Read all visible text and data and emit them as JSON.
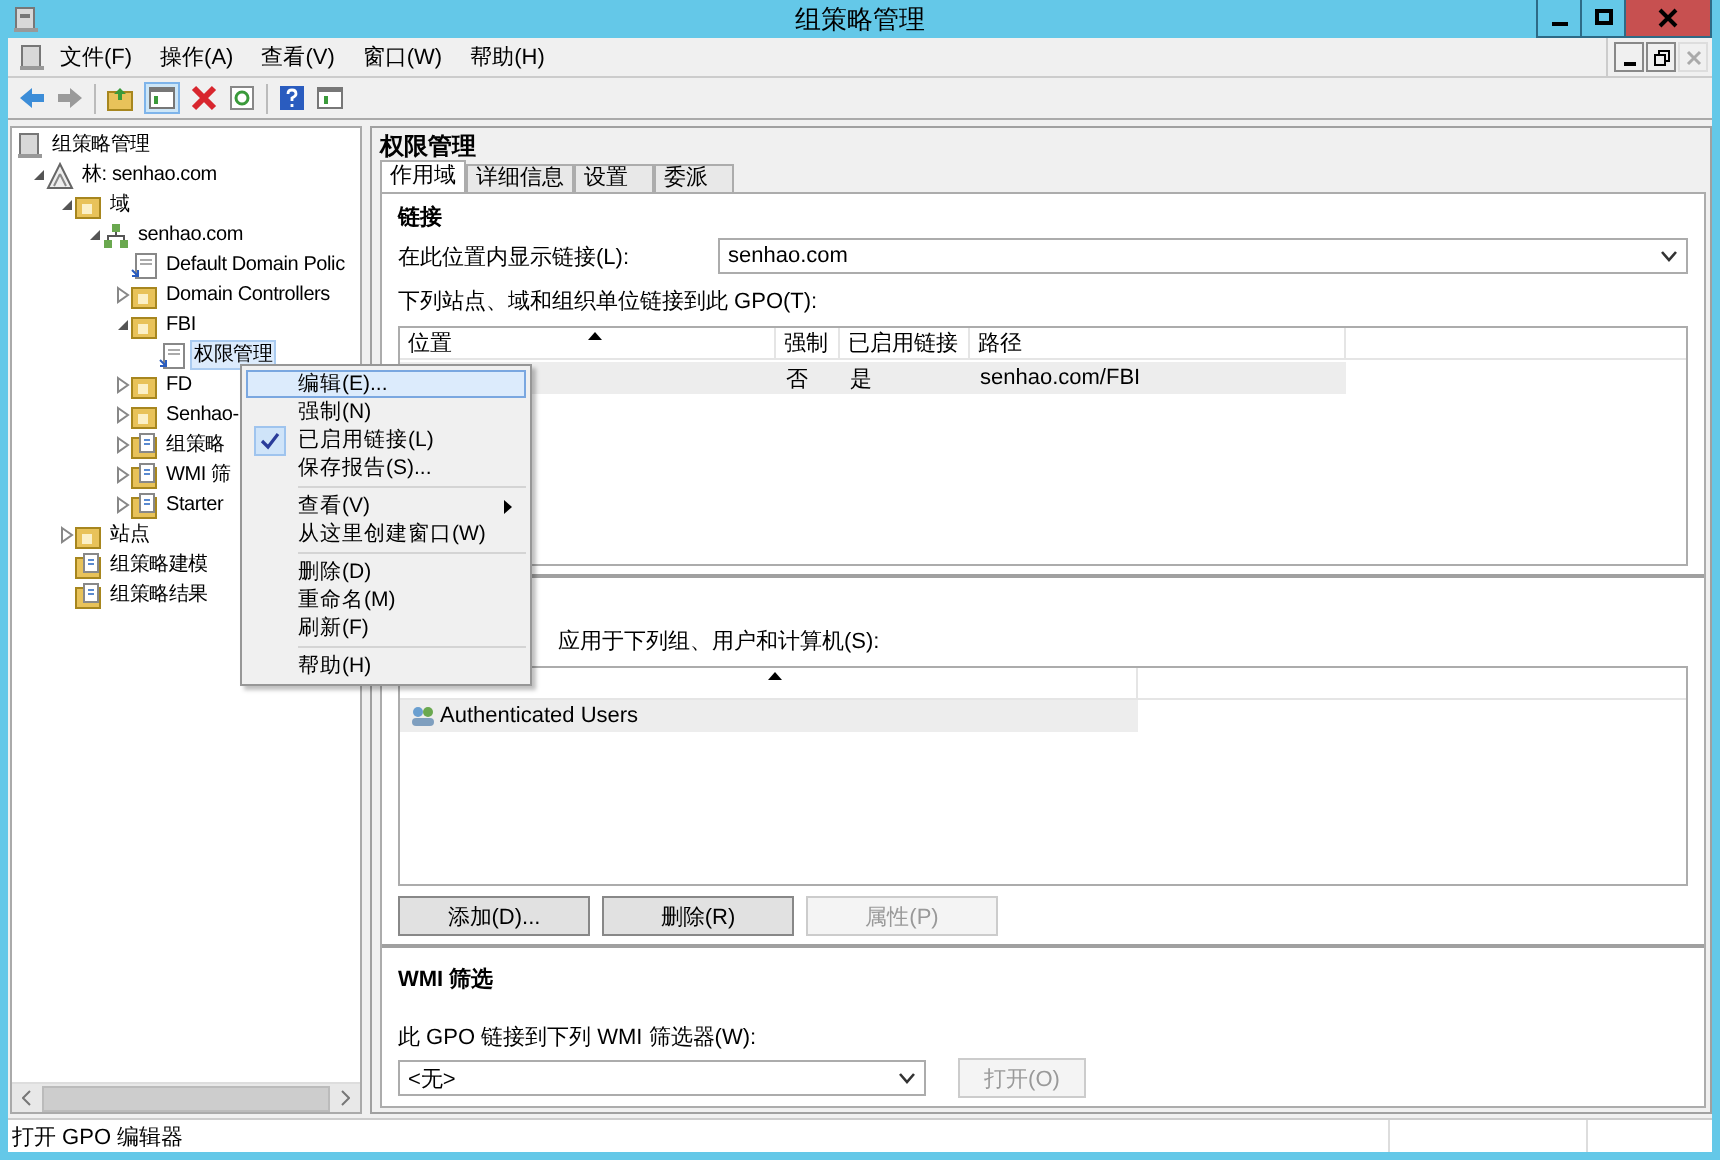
{
  "window": {
    "title": "组策略管理"
  },
  "menu_bar": [
    "文件(F)",
    "操作(A)",
    "查看(V)",
    "窗口(W)",
    "帮助(H)"
  ],
  "tree": [
    {
      "label": "组策略管理",
      "kind": "console",
      "selected": false,
      "children": [
        {
          "label": "林: senhao.com",
          "kind": "forest",
          "expanded": true,
          "selected": false,
          "children": [
            {
              "label": "域",
              "kind": "folder",
              "expanded": true,
              "selected": false,
              "children": [
                {
                  "label": "senhao.com",
                  "kind": "domain",
                  "expanded": true,
                  "selected": false,
                  "children": [
                    {
                      "label": "Default Domain Polic",
                      "kind": "link",
                      "selected": false
                    },
                    {
                      "label": "Domain Controllers",
                      "kind": "folder",
                      "expanded": false,
                      "selected": false
                    },
                    {
                      "label": "FBI",
                      "kind": "folder",
                      "expanded": true,
                      "selected": false,
                      "children": [
                        {
                          "label": "权限管理",
                          "kind": "link",
                          "selected": true
                        }
                      ]
                    },
                    {
                      "label": "FD",
                      "kind": "folder",
                      "expanded": false,
                      "selected": false
                    },
                    {
                      "label": "Senhao-",
                      "kind": "folder",
                      "expanded": false,
                      "selected": false
                    },
                    {
                      "label": "组策略",
                      "kind": "doc",
                      "expanded": false,
                      "selected": false
                    },
                    {
                      "label": "WMI 筛",
                      "kind": "doc",
                      "expanded": false,
                      "selected": false
                    },
                    {
                      "label": "Starter",
                      "kind": "doc",
                      "expanded": false,
                      "selected": false
                    }
                  ]
                }
              ]
            },
            {
              "label": "站点",
              "kind": "folder",
              "expanded": false,
              "selected": false
            },
            {
              "label": "组策略建模",
              "kind": "doc",
              "selected": false
            },
            {
              "label": "组策略结果",
              "kind": "doc",
              "selected": false
            }
          ]
        }
      ]
    }
  ],
  "details": {
    "title": "权限管理",
    "tabs": [
      {
        "label": "作用域",
        "selected": true
      },
      {
        "label": "详细信息",
        "selected": false
      },
      {
        "label": "设置",
        "selected": false
      },
      {
        "label": "委派",
        "selected": false
      }
    ],
    "links": {
      "heading": "链接",
      "location_label": "在此位置内显示链接(L):",
      "location_value": "senhao.com",
      "list_label": "下列站点、域和组织单位链接到此 GPO(T):",
      "columns": [
        "位置",
        "强制",
        "已启用链接",
        "路径"
      ],
      "rows": [
        {
          "enforced": "否",
          "enabled": "是",
          "path": "senhao.com/FBI",
          "selected": true
        }
      ]
    },
    "security_filtering": {
      "label": "应用于下列组、用户和计算机(S):",
      "rows": [
        {
          "name": "Authenticated Users",
          "selected": true
        }
      ],
      "buttons": [
        {
          "label": "添加(D)...",
          "disabled": false
        },
        {
          "label": "删除(R)",
          "disabled": false
        },
        {
          "label": "属性(P)",
          "disabled": true
        }
      ]
    },
    "wmi": {
      "heading": "WMI 筛选",
      "label": "此 GPO 链接到下列 WMI 筛选器(W):",
      "value": "<无>",
      "button": {
        "label": "打开(O)",
        "disabled": true
      }
    }
  },
  "context_menu": [
    {
      "kind": "item",
      "label": "编辑(E)...",
      "checked": false,
      "submenu": false,
      "selected": true
    },
    {
      "kind": "item",
      "label": "强制(N)",
      "checked": false,
      "submenu": false,
      "selected": false
    },
    {
      "kind": "item",
      "label": "已启用链接(L)",
      "checked": true,
      "submenu": false,
      "selected": false
    },
    {
      "kind": "item",
      "label": "保存报告(S)...",
      "checked": false,
      "submenu": false,
      "selected": false
    },
    {
      "kind": "separator"
    },
    {
      "kind": "item",
      "label": "查看(V)",
      "checked": false,
      "submenu": true,
      "selected": false
    },
    {
      "kind": "item",
      "label": "从这里创建窗口(W)",
      "checked": false,
      "submenu": false,
      "selected": false
    },
    {
      "kind": "separator"
    },
    {
      "kind": "item",
      "label": "删除(D)",
      "checked": false,
      "submenu": false,
      "selected": false
    },
    {
      "kind": "item",
      "label": "重命名(M)",
      "checked": false,
      "submenu": false,
      "selected": false
    },
    {
      "kind": "item",
      "label": "刷新(F)",
      "checked": false,
      "submenu": false,
      "selected": false
    },
    {
      "kind": "separator"
    },
    {
      "kind": "item",
      "label": "帮助(H)",
      "checked": false,
      "submenu": false,
      "selected": false
    }
  ],
  "status_bar": "打开 GPO 编辑器"
}
